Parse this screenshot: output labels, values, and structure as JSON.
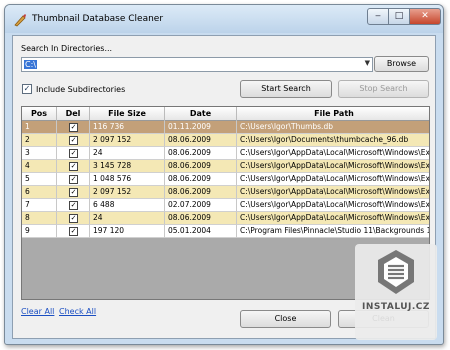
{
  "window": {
    "title": "Thumbnail Database Cleaner"
  },
  "controls": {
    "minimize": "‒",
    "maximize": "□",
    "close": "✕"
  },
  "search": {
    "label": "Search In Directories...",
    "value": "C:\\",
    "browse_label": "Browse",
    "include_subdirs_label": "Include Subdirectories",
    "include_subdirs_checked": true,
    "start_label": "Start Search",
    "stop_label": "Stop Search"
  },
  "table": {
    "columns": [
      "Pos",
      "Del",
      "File Size",
      "Date",
      "File Path"
    ],
    "rows": [
      {
        "pos": "1",
        "del": true,
        "size": "116 736",
        "date": "01.11.2009",
        "path": "C:\\Users\\Igor\\Thumbs.db",
        "selected": true
      },
      {
        "pos": "2",
        "del": true,
        "size": "2 097 152",
        "date": "08.06.2009",
        "path": "C:\\Users\\Igor\\Documents\\thumbcache_96.db"
      },
      {
        "pos": "3",
        "del": true,
        "size": "24",
        "date": "08.06.2009",
        "path": "C:\\Users\\Igor\\AppData\\Local\\Microsoft\\Windows\\Ex..."
      },
      {
        "pos": "4",
        "del": true,
        "size": "3 145 728",
        "date": "08.06.2009",
        "path": "C:\\Users\\Igor\\AppData\\Local\\Microsoft\\Windows\\Ex..."
      },
      {
        "pos": "5",
        "del": true,
        "size": "1 048 576",
        "date": "08.06.2009",
        "path": "C:\\Users\\Igor\\AppData\\Local\\Microsoft\\Windows\\Ex..."
      },
      {
        "pos": "6",
        "del": true,
        "size": "2 097 152",
        "date": "08.06.2009",
        "path": "C:\\Users\\Igor\\AppData\\Local\\Microsoft\\Windows\\Ex..."
      },
      {
        "pos": "7",
        "del": true,
        "size": "6 488",
        "date": "02.07.2009",
        "path": "C:\\Users\\Igor\\AppData\\Local\\Microsoft\\Windows\\Ex..."
      },
      {
        "pos": "8",
        "del": true,
        "size": "24",
        "date": "08.06.2009",
        "path": "C:\\Users\\Igor\\AppData\\Local\\Microsoft\\Windows\\Ex..."
      },
      {
        "pos": "9",
        "del": true,
        "size": "197 120",
        "date": "05.01.2004",
        "path": "C:\\Program Files\\Pinnacle\\Studio 11\\Backgrounds 16..."
      }
    ]
  },
  "footer": {
    "clear_all": "Clear All",
    "check_all": "Check All",
    "close_label": "Close",
    "clean_label": "Clean"
  },
  "watermark": {
    "text": "INSTALUJ.CZ"
  },
  "icons": {
    "checkmark": "✓",
    "dropdown": "▼"
  },
  "colors": {
    "selected_row": "#c3a079",
    "alt_row": "#f4e8b5",
    "link": "#1a4ec2",
    "window_frame": "#c9dcef"
  }
}
